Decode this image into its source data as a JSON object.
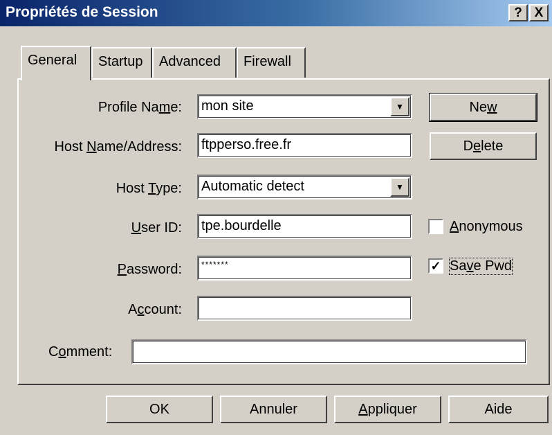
{
  "window": {
    "title": "Propriétés de Session",
    "help_label": "?",
    "close_label": "X"
  },
  "tabs": [
    "General",
    "Startup",
    "Advanced",
    "Firewall"
  ],
  "form": {
    "profile_name": {
      "label": "Profile Name:",
      "value": "mon site"
    },
    "host_name": {
      "label": "Host Name/Address:",
      "value": "ftpperso.free.fr"
    },
    "host_type": {
      "label": "Host Type:",
      "value": "Automatic detect"
    },
    "user_id": {
      "label": "User ID:",
      "value": "tpe.bourdelle"
    },
    "password": {
      "label": "Password:",
      "value": "*******"
    },
    "account": {
      "label": "Account:",
      "value": ""
    },
    "comment": {
      "label": "Comment:",
      "value": ""
    }
  },
  "side_buttons": {
    "new": "New",
    "delete": "Delete"
  },
  "checkboxes": {
    "anonymous": {
      "label": "Anonymous",
      "checked": false
    },
    "save_pwd": {
      "label": "Save Pwd",
      "checked": true
    }
  },
  "footer": {
    "ok": "OK",
    "cancel": "Annuler",
    "apply": "Appliquer",
    "help": "Aide"
  }
}
